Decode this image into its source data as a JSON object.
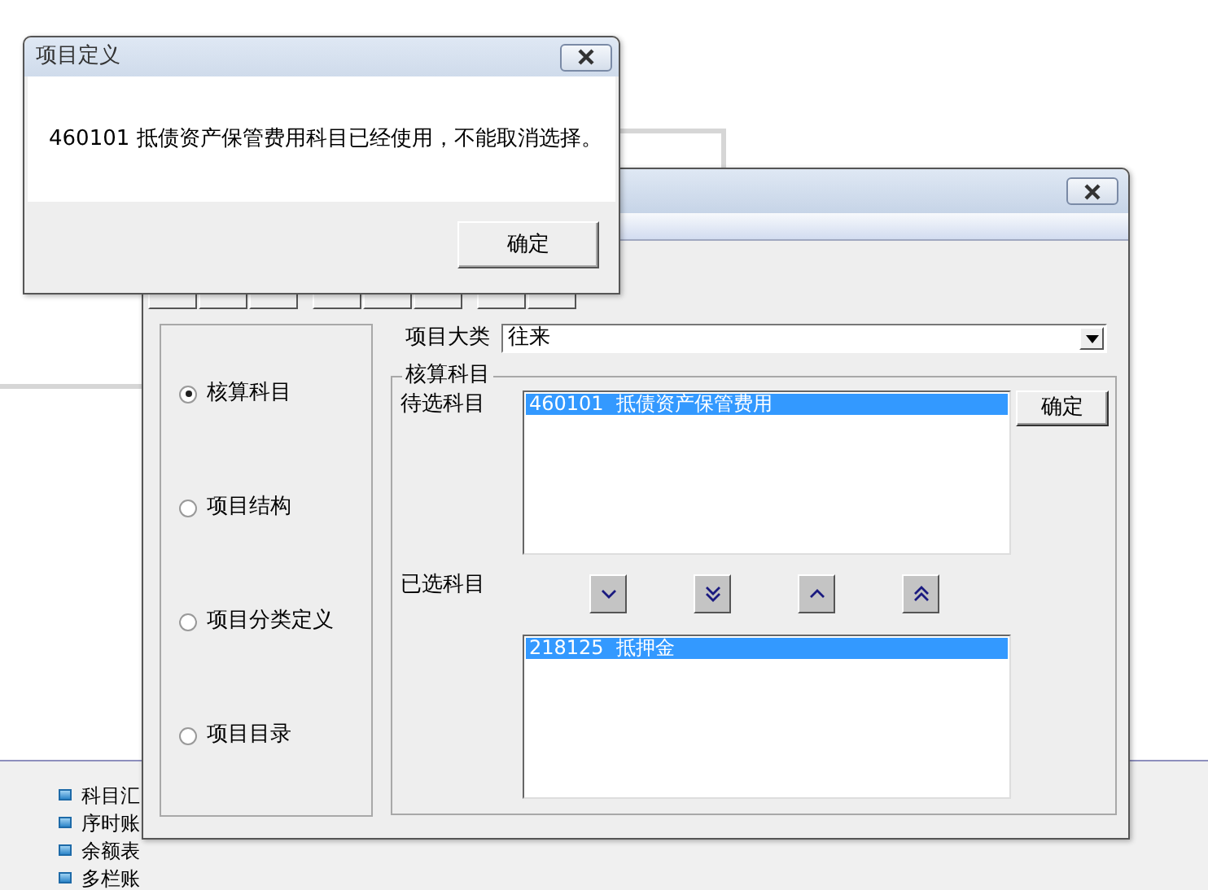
{
  "background_app": {
    "menu_items": [
      {
        "label": "科目汇"
      },
      {
        "label": "序时账"
      },
      {
        "label": "余额表"
      },
      {
        "label": "多栏账"
      }
    ]
  },
  "main_window": {
    "toolbar": [
      {
        "kind": "button"
      },
      {
        "kind": "button"
      },
      {
        "kind": "button"
      },
      {
        "kind": "separator"
      },
      {
        "kind": "button"
      },
      {
        "kind": "button"
      },
      {
        "kind": "button"
      },
      {
        "kind": "separator"
      },
      {
        "kind": "button"
      },
      {
        "kind": "button"
      }
    ],
    "options": [
      {
        "label": "核算科目",
        "selected": true
      },
      {
        "label": "项目结构",
        "selected": false
      },
      {
        "label": "项目分类定义",
        "selected": false
      },
      {
        "label": "项目目录",
        "selected": false
      }
    ],
    "category": {
      "label": "项目大类",
      "value": "往来"
    },
    "group": {
      "title": "核算科目",
      "available_label": "待选科目",
      "available_items": [
        {
          "text": "460101  抵债资产保管费用",
          "selected": true
        }
      ],
      "confirm_button": "确定",
      "selected_label": "已选科目",
      "move_buttons": [
        {
          "kind": "down"
        },
        {
          "kind": "all-down"
        },
        {
          "kind": "up"
        },
        {
          "kind": "all-up"
        }
      ],
      "selected_items": [
        {
          "text": "218125  抵押金",
          "selected": true
        }
      ]
    }
  },
  "dialog": {
    "title": "项目定义",
    "message": "460101 抵债资产保管费用科目已经使用，不能取消选择。",
    "button": "确定"
  }
}
